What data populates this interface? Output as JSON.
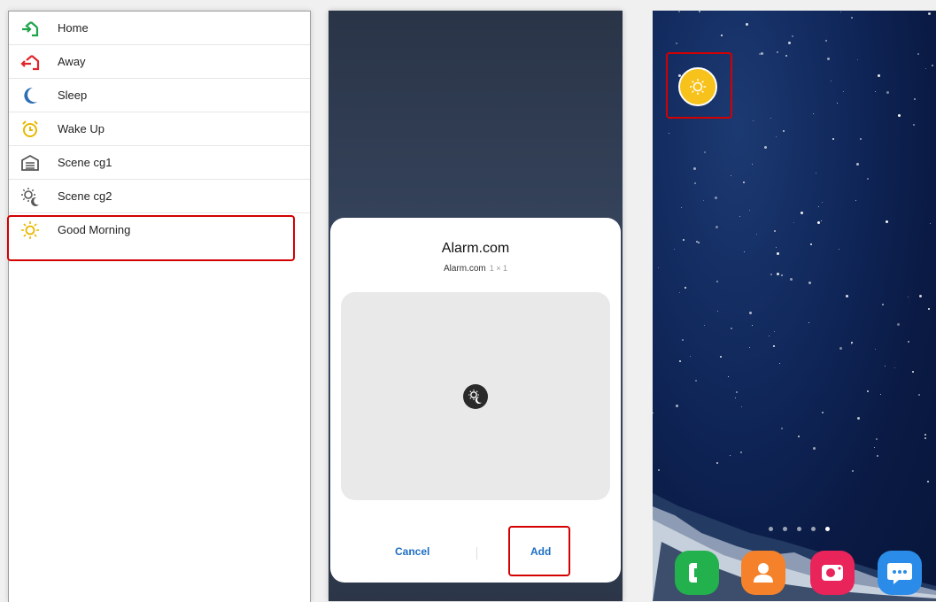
{
  "scene_list": {
    "items": [
      {
        "label": "Home",
        "icon": "home-enter-icon"
      },
      {
        "label": "Away",
        "icon": "away-exit-icon"
      },
      {
        "label": "Sleep",
        "icon": "moon-icon"
      },
      {
        "label": "Wake Up",
        "icon": "alarm-clock-icon"
      },
      {
        "label": "Scene cg1",
        "icon": "garage-icon"
      },
      {
        "label": "Scene cg2",
        "icon": "sun-moon-icon"
      },
      {
        "label": "Good Morning",
        "icon": "sun-icon"
      }
    ],
    "highlighted": "Good Morning"
  },
  "widget_dialog": {
    "title": "Alarm.com",
    "app_name": "Alarm.com",
    "size": "1 × 1",
    "cancel_label": "Cancel",
    "add_label": "Add",
    "preview_icon": "sun-moon-icon"
  },
  "home_screen": {
    "widget_icon": "sun-icon",
    "page_indicator": {
      "count": 5,
      "active": 5
    },
    "dock_apps": [
      {
        "name": "phone-app-icon",
        "color": "#22b14c"
      },
      {
        "name": "contacts-app-icon",
        "color": "#f5822a"
      },
      {
        "name": "camera-app-icon",
        "color": "#e8245a"
      },
      {
        "name": "messages-app-icon",
        "color": "#2a8ce8"
      }
    ]
  },
  "colors": {
    "highlight": "#d40000",
    "home_green": "#1fa34a",
    "away_red": "#e0262b",
    "sleep_blue": "#2d6fb5",
    "wake_yellow": "#e8b800",
    "sun_yellow": "#f7c21b",
    "button_blue": "#1d6fc4"
  }
}
